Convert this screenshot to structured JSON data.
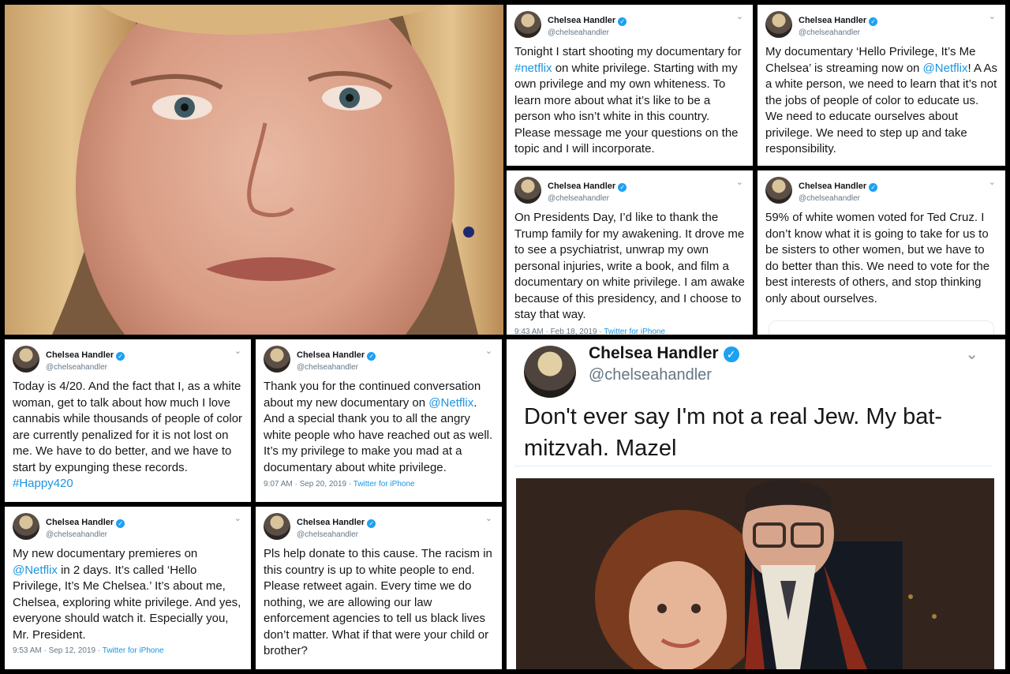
{
  "colors": {
    "link": "#1b95e0",
    "verified": "#1da1f2",
    "background": "#000000"
  },
  "icons": {
    "verified": "verified-badge-icon",
    "more": "chevron-down-icon"
  },
  "verified_glyph": "✓",
  "chevron_glyph": "⌄",
  "tweets": [
    {
      "name": "Chelsea Handler",
      "handle": "@chelseahandler",
      "text_parts": [
        "Tonight I start shooting my documentary for ",
        "#netflix",
        " on white privilege. Starting with my own privilege and my own whiteness. To learn more about what it’s like to be a person who isn’t white in this country. Please message me your questions on the topic and I will incorporate."
      ]
    },
    {
      "name": "Chelsea Handler",
      "handle": "@chelseahandler",
      "text_parts": [
        "My documentary ‘Hello Privilege, It’s Me Chelsea’ is streaming now on ",
        "@Netflix",
        "! A As a white person, we need to learn that it’s not the jobs of people of color to educate us. We need to educate ourselves about privilege. We need to step up and take responsibility."
      ]
    },
    {
      "name": "Chelsea Handler",
      "handle": "@chelseahandler",
      "text": "On Presidents Day, I’d like to thank the Trump family for my awakening. It drove me to see a psychiatrist, unwrap my own personal injuries, write a book, and film a documentary on white privilege. I am awake because of this presidency, and I choose to stay that way.",
      "time": "9:43 AM · Feb 18, 2019 · ",
      "source": "Twitter for iPhone"
    },
    {
      "name": "Chelsea Handler",
      "handle": "@chelseahandler",
      "text": "59% of white women voted for Ted Cruz. I don’t know what it is going to take for us to be sisters to other women, but we have to do better than this. We need to vote for the best interests of others, and stop thinking only about ourselves."
    },
    {
      "name": "Chelsea Handler",
      "handle": "@chelseahandler",
      "text_parts": [
        "Today is 4/20. And the fact that I, as a white woman, get to talk about how much I love cannabis while thousands of people of color are currently penalized for it is not lost on me. We have to do better, and we have to start by expunging these records. ",
        "#Happy420"
      ]
    },
    {
      "name": "Chelsea Handler",
      "handle": "@chelseahandler",
      "text_parts": [
        "Thank you for the continued conversation about my new documentary on ",
        "@Netflix",
        ". And a special thank you to all the angry white people who have reached out as well. It’s my privilege to make you mad at a documentary about white privilege."
      ],
      "time": "9:07 AM · Sep 20, 2019 · ",
      "source": "Twitter for iPhone"
    },
    {
      "name": "Chelsea Handler",
      "handle": "@chelseahandler",
      "text_parts": [
        "My new documentary premieres on ",
        "@Netflix",
        " in 2 days. It’s called ‘Hello Privilege, It’s Me Chelsea.’ It’s about me, Chelsea, exploring white privilege. And yes, everyone should watch it. Especially you, Mr. President."
      ],
      "time": "9:53 AM · Sep 12, 2019 · ",
      "source": "Twitter for iPhone"
    },
    {
      "name": "Chelsea Handler",
      "handle": "@chelseahandler",
      "text": "Pls help donate to this cause. The racism in this country is up to white people to end.  Please retweet again. Every time we do nothing, we are allowing our law enforcement agencies to tell us black lives don’t matter. What if that were your child or brother?"
    },
    {
      "name": "Chelsea Handler",
      "handle": "@chelseahandler",
      "text": "Don't ever say I'm not a real Jew. My bat-mitzvah. Mazel"
    }
  ]
}
